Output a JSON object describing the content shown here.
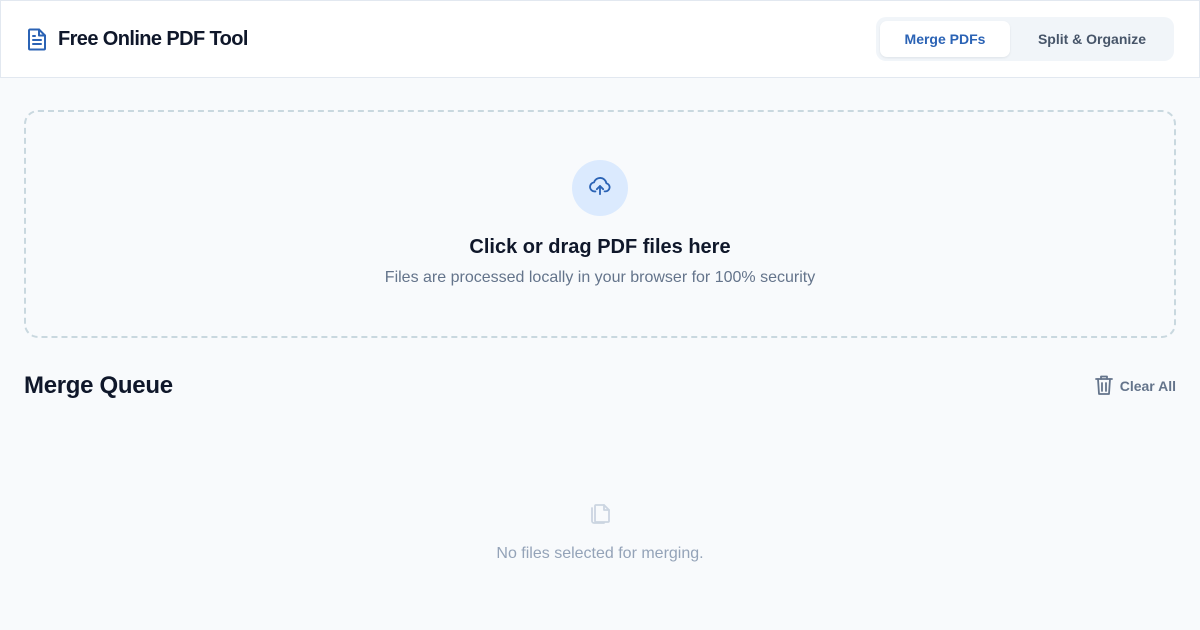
{
  "header": {
    "title": "Free Online PDF Tool",
    "brand_icon": "file-text-icon",
    "tabs": [
      {
        "label": "Merge PDFs",
        "active": true
      },
      {
        "label": "Split & Organize",
        "active": false
      }
    ]
  },
  "dropzone": {
    "icon": "cloud-upload-icon",
    "title": "Click or drag PDF files here",
    "subtitle": "Files are processed locally in your browser for 100% security"
  },
  "queue": {
    "title": "Merge Queue",
    "clear_label": "Clear All",
    "clear_icon": "trash-icon",
    "empty_icon": "files-icon",
    "empty_text": "No files selected for merging."
  },
  "colors": {
    "accent": "#2b63b5",
    "background": "#f8fafc",
    "upload_circle": "#dbeafe",
    "muted_text": "#64748b"
  }
}
